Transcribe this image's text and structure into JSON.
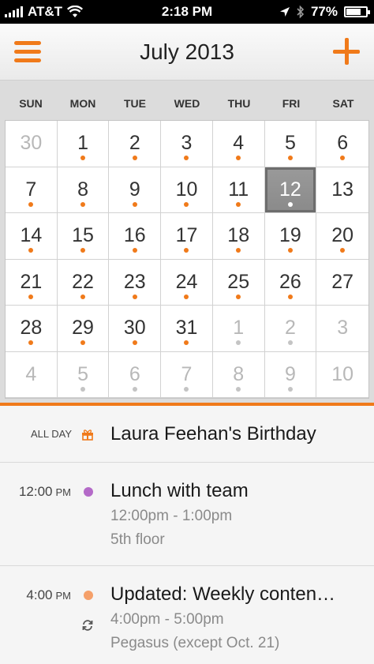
{
  "status_bar": {
    "carrier": "AT&T",
    "time": "2:18 PM",
    "battery": "77%",
    "battery_level": 0.77
  },
  "header": {
    "title": "July 2013",
    "menu_icon": "hamburger-icon",
    "add_icon": "plus-icon",
    "accent_color": "#f07a1a"
  },
  "calendar": {
    "weekdays": [
      "SUN",
      "MON",
      "TUE",
      "WED",
      "THU",
      "FRI",
      "SAT"
    ],
    "days": [
      {
        "n": "30",
        "current": false,
        "event": false
      },
      {
        "n": "1",
        "current": true,
        "event": true
      },
      {
        "n": "2",
        "current": true,
        "event": true
      },
      {
        "n": "3",
        "current": true,
        "event": true
      },
      {
        "n": "4",
        "current": true,
        "event": true
      },
      {
        "n": "5",
        "current": true,
        "event": true
      },
      {
        "n": "6",
        "current": true,
        "event": true
      },
      {
        "n": "7",
        "current": true,
        "event": true
      },
      {
        "n": "8",
        "current": true,
        "event": true
      },
      {
        "n": "9",
        "current": true,
        "event": true
      },
      {
        "n": "10",
        "current": true,
        "event": true
      },
      {
        "n": "11",
        "current": true,
        "event": true
      },
      {
        "n": "12",
        "current": true,
        "event": true,
        "selected": true
      },
      {
        "n": "13",
        "current": true,
        "event": false
      },
      {
        "n": "14",
        "current": true,
        "event": true
      },
      {
        "n": "15",
        "current": true,
        "event": true
      },
      {
        "n": "16",
        "current": true,
        "event": true
      },
      {
        "n": "17",
        "current": true,
        "event": true
      },
      {
        "n": "18",
        "current": true,
        "event": true
      },
      {
        "n": "19",
        "current": true,
        "event": true
      },
      {
        "n": "20",
        "current": true,
        "event": true
      },
      {
        "n": "21",
        "current": true,
        "event": true
      },
      {
        "n": "22",
        "current": true,
        "event": true
      },
      {
        "n": "23",
        "current": true,
        "event": true
      },
      {
        "n": "24",
        "current": true,
        "event": true
      },
      {
        "n": "25",
        "current": true,
        "event": true
      },
      {
        "n": "26",
        "current": true,
        "event": true
      },
      {
        "n": "27",
        "current": true,
        "event": false
      },
      {
        "n": "28",
        "current": true,
        "event": true
      },
      {
        "n": "29",
        "current": true,
        "event": true
      },
      {
        "n": "30",
        "current": true,
        "event": true
      },
      {
        "n": "31",
        "current": true,
        "event": true
      },
      {
        "n": "1",
        "current": false,
        "event": true
      },
      {
        "n": "2",
        "current": false,
        "event": true
      },
      {
        "n": "3",
        "current": false,
        "event": false
      },
      {
        "n": "4",
        "current": false,
        "event": false
      },
      {
        "n": "5",
        "current": false,
        "event": true
      },
      {
        "n": "6",
        "current": false,
        "event": true
      },
      {
        "n": "7",
        "current": false,
        "event": true
      },
      {
        "n": "8",
        "current": false,
        "event": true
      },
      {
        "n": "9",
        "current": false,
        "event": true
      },
      {
        "n": "10",
        "current": false,
        "event": false
      }
    ]
  },
  "agenda": {
    "events": [
      {
        "all_day_label": "ALL DAY",
        "icon": "gift-icon",
        "title": "Laura Feehan's Birthday"
      },
      {
        "time": "12:00",
        "ampm": "PM",
        "dot_color": "#b46ac8",
        "title": "Lunch with team",
        "when": "12:00pm - 1:00pm",
        "where": "5th floor"
      },
      {
        "time": "4:00",
        "ampm": "PM",
        "dot_color": "#f5a06a",
        "icon": "repeat-icon",
        "title": "Updated: Weekly conten…",
        "when": "4:00pm - 5:00pm",
        "where": "Pegasus (except Oct. 21)"
      }
    ]
  }
}
